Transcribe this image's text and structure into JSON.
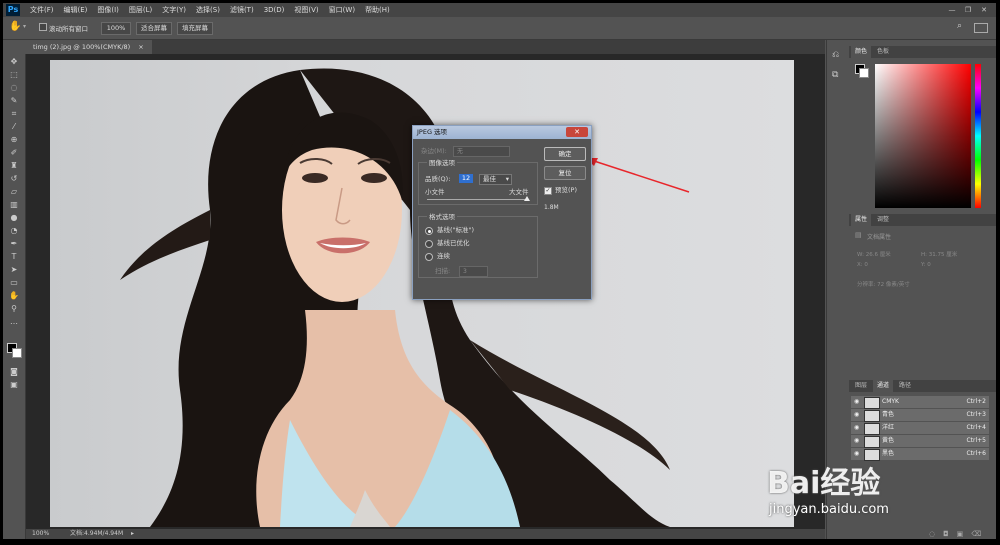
{
  "app": {
    "logo": "Ps"
  },
  "menu": [
    "文件(F)",
    "编辑(E)",
    "图像(I)",
    "图层(L)",
    "文字(Y)",
    "选择(S)",
    "滤镜(T)",
    "3D(D)",
    "视图(V)",
    "窗口(W)",
    "帮助(H)"
  ],
  "window_controls": [
    "—",
    "❐",
    "✕"
  ],
  "options_bar": {
    "scroll_all_label": "滚动所有窗口",
    "zoom_value": "100%",
    "fit_screen": "适合屏幕",
    "fill_screen": "填充屏幕"
  },
  "document_tab": {
    "title": "timg (2).jpg @ 100%(CMYK/8)",
    "close": "×"
  },
  "status": {
    "zoom": "100%",
    "doc_info": "文档:4.94M/4.94M"
  },
  "color_panel": {
    "tabs": [
      "颜色",
      "色板"
    ]
  },
  "properties_panel": {
    "tabs": [
      "属性",
      "调整"
    ],
    "title": "文档属性",
    "w": "W: 26.6 厘米",
    "h": "H: 31.75 厘米",
    "x": "X: 0",
    "y": "Y: 0",
    "resolution": "分辨率: 72 像素/英寸"
  },
  "channels_panel": {
    "tabs": [
      "图层",
      "通道",
      "路径"
    ],
    "rows": [
      {
        "name": "CMYK",
        "key": "Ctrl+2"
      },
      {
        "name": "青色",
        "key": "Ctrl+3"
      },
      {
        "name": "洋红",
        "key": "Ctrl+4"
      },
      {
        "name": "黄色",
        "key": "Ctrl+5"
      },
      {
        "name": "黑色",
        "key": "Ctrl+6"
      }
    ]
  },
  "dialog": {
    "title": "JPEG 选项",
    "close": "✕",
    "matte_label": "杂边(M):",
    "matte_value": "无",
    "image_options": "图像选项",
    "quality_label": "品质(Q):",
    "quality_value": "12",
    "quality_preset": "最佳",
    "small_file": "小文件",
    "large_file": "大文件",
    "quality_fraction": 1.0,
    "format_options": "格式选项",
    "formats": [
      "基线(\"标准\")",
      "基线已优化",
      "连续"
    ],
    "selected_format": 0,
    "scans_label": "扫描:",
    "scans_value": "3",
    "ok": "确定",
    "reset": "复位",
    "preview_label": "预览(P)",
    "preview_checked": true,
    "file_size": "1.8M"
  },
  "watermark": {
    "brand": "Bai经验",
    "url": "jingyan.baidu.com"
  },
  "colors": {
    "annotation_arrow": "#e8262b",
    "ps_blue": "#31a8ff"
  }
}
